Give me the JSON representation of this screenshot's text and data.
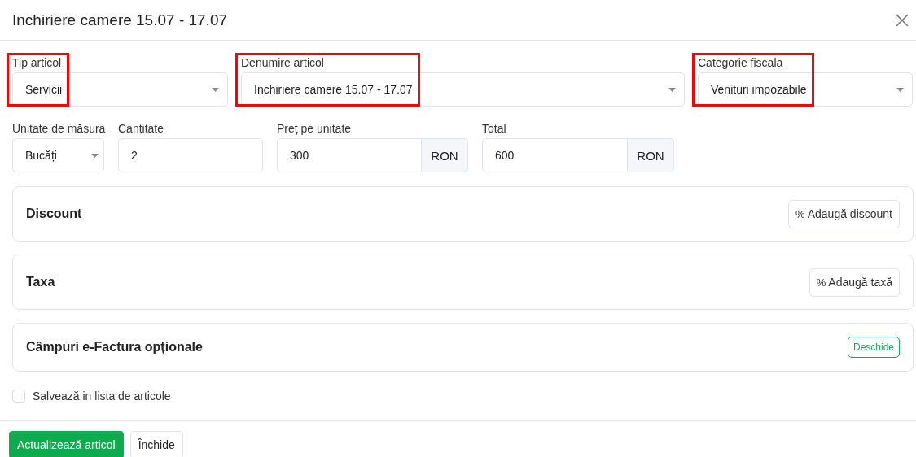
{
  "dialog": {
    "title": "Inchiriere camere 15.07 - 17.07"
  },
  "fields_top": [
    {
      "label": "Tip articol",
      "value": "Servicii",
      "kind": "select",
      "highlighted": true
    },
    {
      "label": "Denumire articol",
      "value": "Inchiriere camere 15.07 - 17.07",
      "kind": "select",
      "highlighted": true
    },
    {
      "label": "Categorie fiscala",
      "value": "Venituri impozabile",
      "kind": "select",
      "highlighted": true
    }
  ],
  "fields_bottom": [
    {
      "label": "Unitate de măsura",
      "value": "Bucăți",
      "kind": "select"
    },
    {
      "label": "Cantitate",
      "value": "2",
      "kind": "input"
    },
    {
      "label": "Preț pe unitate",
      "value": "300",
      "kind": "input",
      "suffix": "RON"
    },
    {
      "label": "Total",
      "value": "600",
      "kind": "input",
      "suffix": "RON"
    }
  ],
  "sections": [
    {
      "title": "Discount",
      "kind": "add",
      "button": {
        "icon": "%",
        "label": "Adaugă discount"
      }
    },
    {
      "title": "Taxa",
      "kind": "add",
      "button": {
        "icon": "%",
        "label": "Adaugă taxă"
      }
    },
    {
      "title": "Câmpuri e-Factura opționale",
      "kind": "open",
      "button": {
        "label": "Deschide"
      }
    }
  ],
  "save_checkbox": {
    "label": "Salvează in lista de articole",
    "checked": false
  },
  "footer_buttons": [
    {
      "label": "Actualizează articol",
      "kind": "primary"
    },
    {
      "label": "Închide",
      "kind": "secondary"
    }
  ]
}
